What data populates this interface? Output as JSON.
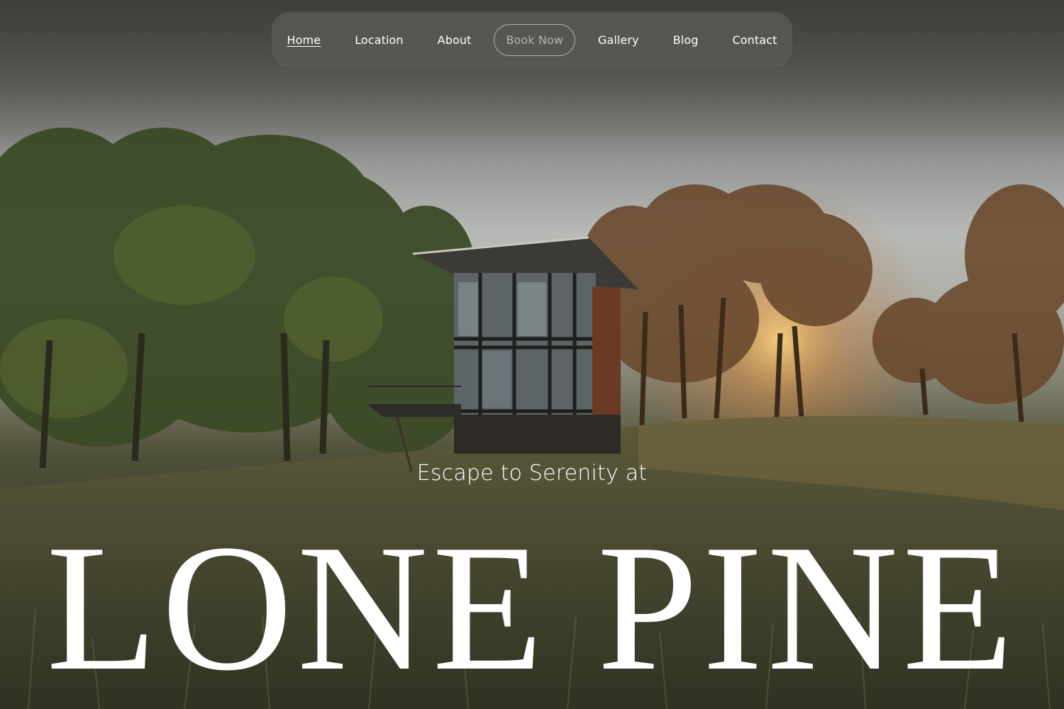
{
  "nav": {
    "items": [
      {
        "label": "Home",
        "active": true
      },
      {
        "label": "Location"
      },
      {
        "label": "About"
      },
      {
        "label": "Book Now",
        "style": "outlined"
      },
      {
        "label": "Gallery"
      },
      {
        "label": "Blog"
      },
      {
        "label": "Contact"
      }
    ]
  },
  "hero": {
    "tagline": "Escape to Serenity at",
    "brand": "LONE PINE",
    "background_image": "cabin-in-meadow-at-sunset"
  },
  "colors": {
    "text": "#ffffff",
    "nav_background": "#555a52"
  }
}
